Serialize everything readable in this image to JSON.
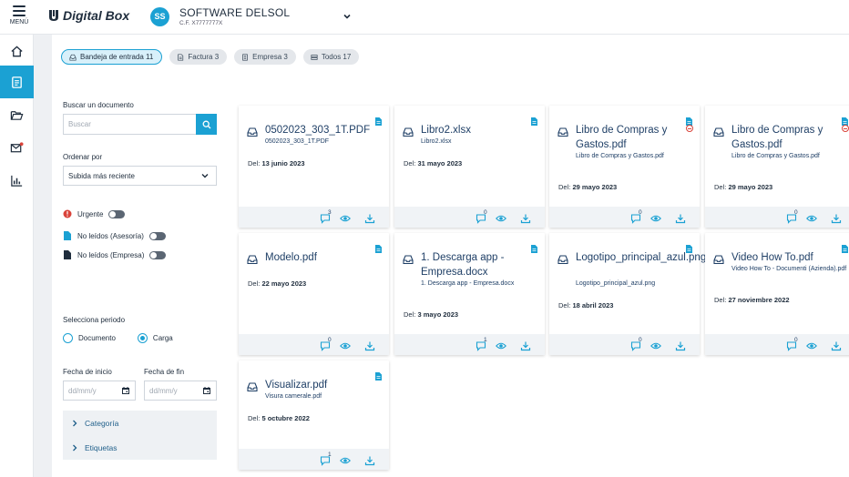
{
  "header": {
    "menu_label": "MENÚ",
    "brand": "Digital Box",
    "company_initials": "SS",
    "company_name": "SOFTWARE DELSOL",
    "company_id": "C.F. X7777777X"
  },
  "tabs": [
    {
      "label": "Bandeja de entrada 11",
      "icon": "inbox-icon",
      "active": true
    },
    {
      "label": "Factura 3",
      "icon": "document-icon",
      "active": false
    },
    {
      "label": "Empresa 3",
      "icon": "building-icon",
      "active": false
    },
    {
      "label": "Todos 17",
      "icon": "stack-icon",
      "active": false
    }
  ],
  "filters": {
    "search_label": "Buscar un documento",
    "search_placeholder": "Buscar",
    "sort_label": "Ordenar por",
    "sort_value": "Subida más reciente",
    "toggles": [
      "Urgente",
      "No leídos (Asesoría)",
      "No leídos (Empresa)"
    ],
    "period_label": "Selecciona periodo",
    "period_options": [
      "Documento",
      "Carga"
    ],
    "period_selected": "Carga",
    "start_label": "Fecha de inicio",
    "end_label": "Fecha de fin",
    "date_placeholder": "dd/mm/y",
    "accordion": [
      "Categoría",
      "Etiquetas"
    ]
  },
  "del_prefix": "Del:",
  "accent": "#1ba1d3",
  "documents": [
    {
      "title": "0502023_303_1T.PDF",
      "file": "0502023_303_1T.PDF",
      "date": "13 junio 2023",
      "comments": "3",
      "warn": false
    },
    {
      "title": "Libro2.xlsx",
      "file": "Libro2.xlsx",
      "date": "31 mayo 2023",
      "comments": "0",
      "warn": false
    },
    {
      "title": "Libro de Compras y Gastos.pdf",
      "file": "Libro de Compras y Gastos.pdf",
      "date": "29 mayo 2023",
      "comments": "0",
      "warn": true
    },
    {
      "title": "Libro de Compras y Gastos.pdf",
      "file": "Libro de Compras y Gastos.pdf",
      "date": "29 mayo 2023",
      "comments": "0",
      "warn": true
    },
    {
      "title": "Modelo.pdf",
      "file": "",
      "date": "22 mayo 2023",
      "comments": "0",
      "warn": false
    },
    {
      "title": "1. Descarga app - Empresa.docx",
      "file": "1. Descarga app - Empresa.docx",
      "date": "3 mayo 2023",
      "comments": "1",
      "warn": false
    },
    {
      "title": "Logotipo_principal_azul.png",
      "file": "Logotipo_principal_azul.png",
      "date": "18 abril 2023",
      "comments": "0",
      "warn": false
    },
    {
      "title": "Video How To.pdf",
      "file": "Video How To - Documenti (Azienda).pdf",
      "date": "27 noviembre 2022",
      "comments": "0",
      "warn": false
    },
    {
      "title": "Visualizar.pdf",
      "file": "Visura camerale.pdf",
      "date": "5 octubre 2022",
      "comments": "1",
      "warn": false
    }
  ]
}
